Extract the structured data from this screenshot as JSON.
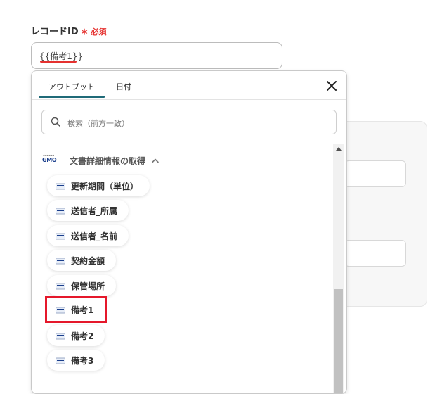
{
  "field": {
    "label": "レコードID",
    "required_mark": "＊ 必須",
    "input_value": "{{備考1}}"
  },
  "dropdown": {
    "tabs": [
      {
        "label": "アウトプット",
        "active": true
      },
      {
        "label": "日付",
        "active": false
      }
    ],
    "search_placeholder": "検索（前方一致）",
    "group": {
      "logo_text": "GMO",
      "title": "文書詳細情報の取得",
      "expanded": true
    },
    "items": [
      {
        "label": "更新期間（単位）",
        "highlighted": false
      },
      {
        "label": "送信者_所属",
        "highlighted": false
      },
      {
        "label": "送信者_名前",
        "highlighted": false
      },
      {
        "label": "契約金額",
        "highlighted": false
      },
      {
        "label": "保管場所",
        "highlighted": false
      },
      {
        "label": "備考1",
        "highlighted": true
      },
      {
        "label": "備考2",
        "highlighted": false
      },
      {
        "label": "備考3",
        "highlighted": false
      }
    ]
  },
  "colors": {
    "accent_tab": "#1f6a78",
    "required": "#e5312f",
    "highlight": "#e5182b"
  }
}
